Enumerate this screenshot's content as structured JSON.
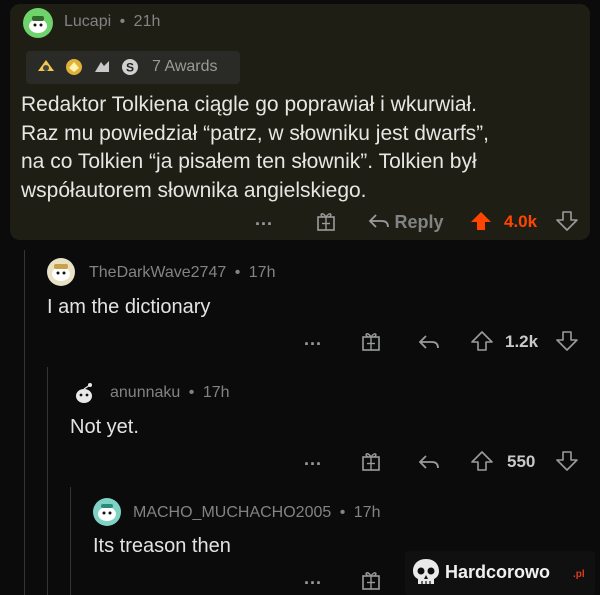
{
  "post": {
    "author": "Lucapi",
    "sep": "•",
    "time": "21h",
    "awards_label": "7 Awards",
    "body_lines": [
      "Redaktor Tolkiena ciągle go poprawiał i wkurwiał.",
      "Raz mu powiedział “patrz, w słowniku jest dwarfs”,",
      "na co Tolkien “ja pisałem ten słownik”. Tolkien był",
      "współautorem słownika angielskiego."
    ],
    "more": "...",
    "reply_label": "Reply",
    "score": "4.0k",
    "upvote_color": "#ff4500"
  },
  "comments": [
    {
      "author": "TheDarkWave2747",
      "sep": "•",
      "time": "17h",
      "text": "I am the dictionary",
      "more": "...",
      "score": "1.2k"
    },
    {
      "author": "anunnaku",
      "sep": "•",
      "time": "17h",
      "text": "Not yet.",
      "more": "...",
      "score": "550"
    },
    {
      "author": "MACHO_MUCHACHO2005",
      "sep": "•",
      "time": "17h",
      "text": "Its treason then",
      "more": "..."
    }
  ],
  "watermark": {
    "brand": "Hardcorowo",
    "tld": ".pl"
  },
  "icons": [
    "snoo-avatar-icon",
    "award-icon",
    "gift-icon",
    "reply-arrow-icon",
    "upvote-icon",
    "downvote-icon",
    "skull-icon"
  ]
}
